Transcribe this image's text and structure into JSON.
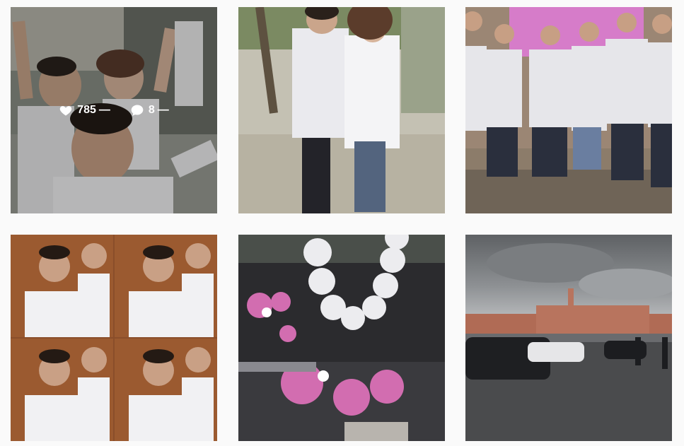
{
  "posts": [
    {
      "name": "post-selfie-group",
      "likes": "785",
      "comments": "8",
      "likes_suffix": "—",
      "comments_suffix": "—",
      "hovered": true
    },
    {
      "name": "post-couple-street",
      "hovered": false
    },
    {
      "name": "post-group-wall",
      "hovered": false
    },
    {
      "name": "post-collage",
      "hovered": false
    },
    {
      "name": "post-flowers",
      "hovered": false
    },
    {
      "name": "post-square-sky",
      "hovered": false
    }
  ],
  "icons": {
    "like": "heart-icon",
    "comment": "comment-bubble-icon"
  },
  "colors": {
    "page_background": "#fafafa",
    "overlay_text": "#ffffff"
  }
}
